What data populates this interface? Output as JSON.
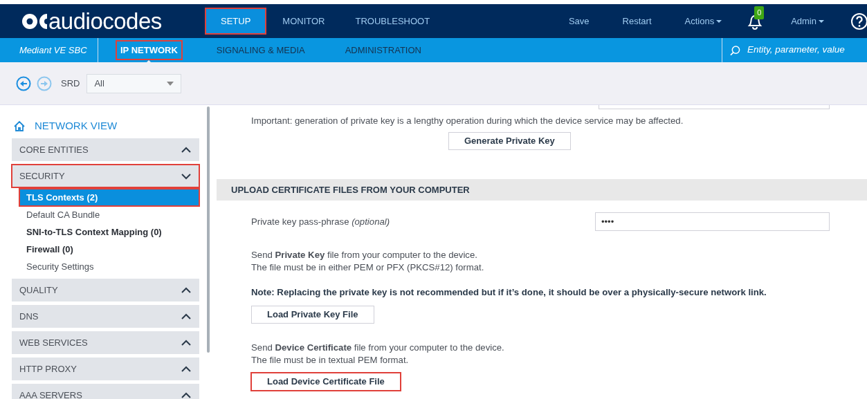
{
  "header": {
    "logo": "audiocodes",
    "tabs": [
      {
        "label": "SETUP",
        "selected": true,
        "highlighted": true
      },
      {
        "label": "MONITOR",
        "selected": false,
        "highlighted": false
      },
      {
        "label": "TROUBLESHOOT",
        "selected": false,
        "highlighted": false
      }
    ],
    "actions": [
      {
        "label": "Save",
        "kind": "link"
      },
      {
        "label": "Restart",
        "kind": "link"
      },
      {
        "label": "Actions",
        "kind": "dropdown"
      }
    ],
    "notifications": {
      "count": "0"
    },
    "user": "Admin"
  },
  "subnav": {
    "device": "Mediant VE SBC",
    "tabs": [
      {
        "label": "IP NETWORK",
        "selected": true,
        "highlighted": true
      },
      {
        "label": "SIGNALING & MEDIA",
        "selected": false,
        "highlighted": false
      },
      {
        "label": "ADMINISTRATION",
        "selected": false,
        "highlighted": false
      }
    ],
    "search": {
      "placeholder": "Entity, parameter, value"
    }
  },
  "toolbar": {
    "srd_label": "SRD",
    "srd_value": "All"
  },
  "sidebar": {
    "title": "NETWORK VIEW",
    "groups": [
      {
        "label": "CORE ENTITIES",
        "expanded": false,
        "highlighted": false
      },
      {
        "label": "SECURITY",
        "expanded": true,
        "highlighted": true,
        "children": [
          {
            "label": "TLS Contexts (2)",
            "bold": true,
            "selected": true,
            "highlighted": true
          },
          {
            "label": "Default CA Bundle",
            "bold": false,
            "selected": false,
            "highlighted": false
          },
          {
            "label": "SNI-to-TLS Context Mapping (0)",
            "bold": true,
            "selected": false,
            "highlighted": false
          },
          {
            "label": "Firewall (0)",
            "bold": true,
            "selected": false,
            "highlighted": false
          },
          {
            "label": "Security Settings",
            "bold": false,
            "selected": false,
            "highlighted": false
          }
        ]
      },
      {
        "label": "QUALITY",
        "expanded": false,
        "highlighted": false
      },
      {
        "label": "DNS",
        "expanded": false,
        "highlighted": false
      },
      {
        "label": "WEB SERVICES",
        "expanded": false,
        "highlighted": false
      },
      {
        "label": "HTTP PROXY",
        "expanded": false,
        "highlighted": false
      },
      {
        "label": "AAA SERVERS",
        "expanded": false,
        "highlighted": false
      }
    ]
  },
  "content": [
    {
      "kind": "text",
      "text": "Important: generation of private key is a lengthy operation during which the device service may be affected."
    },
    {
      "kind": "center_button",
      "label": "Generate Private Key",
      "highlighted": false
    },
    {
      "kind": "section",
      "text": "UPLOAD CERTIFICATE FILES FROM YOUR COMPUTER"
    },
    {
      "kind": "field",
      "label": "Private key pass-phrase *(optional)*",
      "value": "••••"
    },
    {
      "kind": "text",
      "text": "Send **Private Key** file from your computer to the device."
    },
    {
      "kind": "text",
      "text": "The file must be in either PEM or PFX (PKCS#12) format."
    },
    {
      "kind": "note",
      "text": "Note: Replacing the private key is not recommended but if it’s done, it should be over a physically-secure network link."
    },
    {
      "kind": "button",
      "label": "Load Private Key File",
      "highlighted": false
    },
    {
      "kind": "text",
      "text": "Send **Device Certificate** file from your computer to the device."
    },
    {
      "kind": "text",
      "text": "The file must be in textual PEM format."
    },
    {
      "kind": "button",
      "label": "Load Device Certificate File",
      "highlighted": true
    }
  ]
}
